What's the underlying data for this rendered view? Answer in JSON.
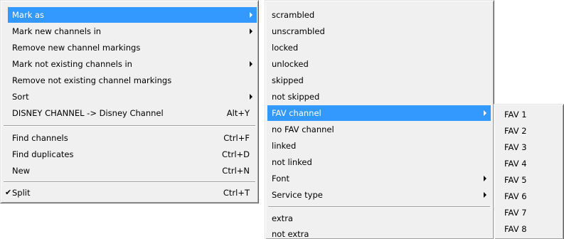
{
  "main_menu": {
    "items": [
      {
        "label": "Mark as",
        "shortcut": "",
        "submenu": true,
        "highlighted": true,
        "checked": false
      },
      {
        "label": "Mark new channels in",
        "shortcut": "",
        "submenu": true,
        "highlighted": false,
        "checked": false
      },
      {
        "label": "Remove new channel markings",
        "shortcut": "",
        "submenu": false,
        "highlighted": false,
        "checked": false
      },
      {
        "label": "Mark not existing channels in",
        "shortcut": "",
        "submenu": true,
        "highlighted": false,
        "checked": false
      },
      {
        "label": "Remove not existing channel markings",
        "shortcut": "",
        "submenu": false,
        "highlighted": false,
        "checked": false
      },
      {
        "label": "Sort",
        "shortcut": "",
        "submenu": true,
        "highlighted": false,
        "checked": false
      },
      {
        "label": "DISNEY CHANNEL -> Disney Channel",
        "shortcut": "Alt+Y",
        "submenu": false,
        "highlighted": false,
        "checked": false
      },
      {
        "label": "Find channels",
        "shortcut": "Ctrl+F",
        "submenu": false,
        "highlighted": false,
        "checked": false
      },
      {
        "label": "Find duplicates",
        "shortcut": "Ctrl+D",
        "submenu": false,
        "highlighted": false,
        "checked": false
      },
      {
        "label": "New",
        "shortcut": "Ctrl+N",
        "submenu": false,
        "highlighted": false,
        "checked": false
      },
      {
        "label": "Split",
        "shortcut": "Ctrl+T",
        "submenu": false,
        "highlighted": false,
        "checked": true
      }
    ]
  },
  "mark_as_menu": {
    "items": [
      {
        "label": "scrambled",
        "submenu": false,
        "highlighted": false
      },
      {
        "label": "unscrambled",
        "submenu": false,
        "highlighted": false
      },
      {
        "label": "locked",
        "submenu": false,
        "highlighted": false
      },
      {
        "label": "unlocked",
        "submenu": false,
        "highlighted": false
      },
      {
        "label": "skipped",
        "submenu": false,
        "highlighted": false
      },
      {
        "label": "not skipped",
        "submenu": false,
        "highlighted": false
      },
      {
        "label": "FAV channel",
        "submenu": true,
        "highlighted": true
      },
      {
        "label": "no FAV channel",
        "submenu": false,
        "highlighted": false
      },
      {
        "label": "linked",
        "submenu": false,
        "highlighted": false
      },
      {
        "label": "not linked",
        "submenu": false,
        "highlighted": false
      },
      {
        "label": "Font",
        "submenu": true,
        "highlighted": false
      },
      {
        "label": "Service type",
        "submenu": true,
        "highlighted": false
      },
      {
        "label": "extra",
        "submenu": false,
        "highlighted": false
      },
      {
        "label": "not extra",
        "submenu": false,
        "highlighted": false
      }
    ]
  },
  "fav_menu": {
    "items": [
      "FAV 1",
      "FAV 2",
      "FAV 3",
      "FAV 4",
      "FAV 5",
      "FAV 6",
      "FAV 7",
      "FAV 8"
    ]
  },
  "icons": {
    "checkmark": "checkmark-icon",
    "submenu_arrow": "submenu-arrow-icon"
  },
  "colors": {
    "menu_background": "#f0f0f0",
    "highlight": "#3399ff",
    "highlight_text": "#ffffff",
    "text": "#000000"
  }
}
